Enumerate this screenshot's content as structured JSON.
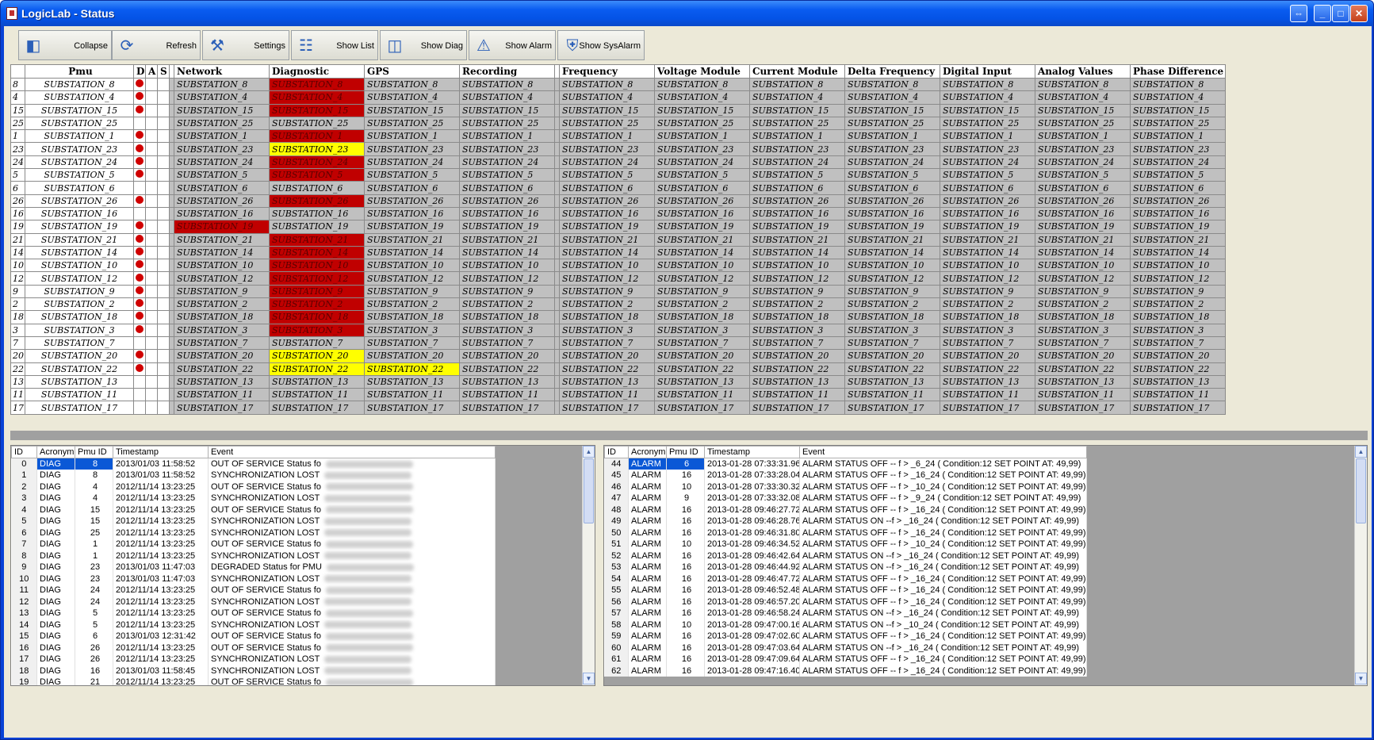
{
  "window": {
    "title": "LogicLab -  Status"
  },
  "toolbar": [
    {
      "label": "Collapse",
      "icon": "collapse-icon"
    },
    {
      "label": "Refresh",
      "icon": "refresh-icon"
    },
    {
      "label": "Settings",
      "icon": "settings-icon"
    },
    {
      "label": "Show List",
      "icon": "list-icon"
    },
    {
      "label": "Show Diag",
      "icon": "diag-icon"
    },
    {
      "label": "Show Alarm",
      "icon": "alarm-icon"
    },
    {
      "label": "Show SysAlarm",
      "icon": "sysalarm-icon"
    }
  ],
  "grid": {
    "columns": [
      "Pmu",
      "D",
      "A",
      "S",
      "Network",
      "Diagnostic",
      "GPS",
      "Recording",
      "Frequency",
      "Voltage Module",
      "Current Module",
      "Delta Frequency",
      "Digital Input",
      "Analog Values",
      "Phase Difference"
    ],
    "status_colors": {
      "red": "#c00000",
      "yellow": "#ffff00",
      "gray": "#c0c0c0"
    },
    "rows": [
      {
        "id": "8",
        "name": "SUBSTATION_8",
        "d": true,
        "net": "",
        "diag": "red",
        "gps": ""
      },
      {
        "id": "4",
        "name": "SUBSTATION_4",
        "d": true,
        "net": "",
        "diag": "red",
        "gps": ""
      },
      {
        "id": "15",
        "name": "SUBSTATION_15",
        "d": true,
        "net": "",
        "diag": "red",
        "gps": ""
      },
      {
        "id": "25",
        "name": "SUBSTATION_25",
        "d": false,
        "net": "",
        "diag": "",
        "gps": ""
      },
      {
        "id": "1",
        "name": "SUBSTATION_1",
        "d": true,
        "net": "",
        "diag": "red",
        "gps": ""
      },
      {
        "id": "23",
        "name": "SUBSTATION_23",
        "d": true,
        "net": "",
        "diag": "yellow",
        "gps": ""
      },
      {
        "id": "24",
        "name": "SUBSTATION_24",
        "d": true,
        "net": "",
        "diag": "red",
        "gps": ""
      },
      {
        "id": "5",
        "name": "SUBSTATION_5",
        "d": true,
        "net": "",
        "diag": "red",
        "gps": ""
      },
      {
        "id": "6",
        "name": "SUBSTATION_6",
        "d": false,
        "net": "",
        "diag": "",
        "gps": ""
      },
      {
        "id": "26",
        "name": "SUBSTATION_26",
        "d": true,
        "net": "",
        "diag": "red",
        "gps": ""
      },
      {
        "id": "16",
        "name": "SUBSTATION_16",
        "d": false,
        "net": "",
        "diag": "",
        "gps": ""
      },
      {
        "id": "19",
        "name": "SUBSTATION_19",
        "d": true,
        "net": "red",
        "diag": "",
        "gps": ""
      },
      {
        "id": "21",
        "name": "SUBSTATION_21",
        "d": true,
        "net": "",
        "diag": "red",
        "gps": ""
      },
      {
        "id": "14",
        "name": "SUBSTATION_14",
        "d": true,
        "net": "",
        "diag": "red",
        "gps": ""
      },
      {
        "id": "10",
        "name": "SUBSTATION_10",
        "d": true,
        "net": "",
        "diag": "red",
        "gps": ""
      },
      {
        "id": "12",
        "name": "SUBSTATION_12",
        "d": true,
        "net": "",
        "diag": "red",
        "gps": ""
      },
      {
        "id": "9",
        "name": "SUBSTATION_9",
        "d": true,
        "net": "",
        "diag": "red",
        "gps": ""
      },
      {
        "id": "2",
        "name": "SUBSTATION_2",
        "d": true,
        "net": "",
        "diag": "red",
        "gps": ""
      },
      {
        "id": "18",
        "name": "SUBSTATION_18",
        "d": true,
        "net": "",
        "diag": "red",
        "gps": ""
      },
      {
        "id": "3",
        "name": "SUBSTATION_3",
        "d": true,
        "net": "",
        "diag": "red",
        "gps": ""
      },
      {
        "id": "7",
        "name": "SUBSTATION_7",
        "d": false,
        "net": "",
        "diag": "",
        "gps": ""
      },
      {
        "id": "20",
        "name": "SUBSTATION_20",
        "d": true,
        "net": "",
        "diag": "yellow",
        "gps": ""
      },
      {
        "id": "22",
        "name": "SUBSTATION_22",
        "d": true,
        "net": "",
        "diag": "yellow",
        "gps": "yellow"
      },
      {
        "id": "13",
        "name": "SUBSTATION_13",
        "d": false,
        "net": "",
        "diag": "",
        "gps": ""
      },
      {
        "id": "11",
        "name": "SUBSTATION_11",
        "d": false,
        "net": "",
        "diag": "",
        "gps": ""
      },
      {
        "id": "17",
        "name": "SUBSTATION_17",
        "d": false,
        "net": "",
        "diag": "",
        "gps": ""
      }
    ]
  },
  "diag_log": {
    "columns": [
      "ID",
      "Acronym",
      "Pmu ID",
      "Timestamp",
      "Event"
    ],
    "rows": [
      [
        "0",
        "DIAG",
        "8",
        "2013/01/03 11:58:52",
        "OUT OF SERVICE Status fo"
      ],
      [
        "1",
        "DIAG",
        "8",
        "2013/01/03 11:58:52",
        "SYNCHRONIZATION LOST"
      ],
      [
        "2",
        "DIAG",
        "4",
        "2012/11/14 13:23:25",
        "OUT OF SERVICE Status fo"
      ],
      [
        "3",
        "DIAG",
        "4",
        "2012/11/14 13:23:25",
        "SYNCHRONIZATION LOST"
      ],
      [
        "4",
        "DIAG",
        "15",
        "2012/11/14 13:23:25",
        "OUT OF SERVICE Status fo"
      ],
      [
        "5",
        "DIAG",
        "15",
        "2012/11/14 13:23:25",
        "SYNCHRONIZATION LOST"
      ],
      [
        "6",
        "DIAG",
        "25",
        "2012/11/14 13:23:25",
        "SYNCHRONIZATION LOST"
      ],
      [
        "7",
        "DIAG",
        "1",
        "2012/11/14 13:23:25",
        "OUT OF SERVICE Status fo"
      ],
      [
        "8",
        "DIAG",
        "1",
        "2012/11/14 13:23:25",
        "SYNCHRONIZATION LOST"
      ],
      [
        "9",
        "DIAG",
        "23",
        "2013/01/03 11:47:03",
        "DEGRADED Status for PMU"
      ],
      [
        "10",
        "DIAG",
        "23",
        "2013/01/03 11:47:03",
        "SYNCHRONIZATION LOST"
      ],
      [
        "11",
        "DIAG",
        "24",
        "2012/11/14 13:23:25",
        "OUT OF SERVICE Status fo"
      ],
      [
        "12",
        "DIAG",
        "24",
        "2012/11/14 13:23:25",
        "SYNCHRONIZATION LOST"
      ],
      [
        "13",
        "DIAG",
        "5",
        "2012/11/14 13:23:25",
        "OUT OF SERVICE Status fo"
      ],
      [
        "14",
        "DIAG",
        "5",
        "2012/11/14 13:23:25",
        "SYNCHRONIZATION LOST"
      ],
      [
        "15",
        "DIAG",
        "6",
        "2013/01/03 12:31:42",
        "OUT OF SERVICE Status fo"
      ],
      [
        "16",
        "DIAG",
        "26",
        "2012/11/14 13:23:25",
        "OUT OF SERVICE Status fo"
      ],
      [
        "17",
        "DIAG",
        "26",
        "2012/11/14 13:23:25",
        "SYNCHRONIZATION LOST"
      ],
      [
        "18",
        "DIAG",
        "16",
        "2013/01/03 11:58:45",
        "SYNCHRONIZATION LOST"
      ],
      [
        "19",
        "DIAG",
        "21",
        "2012/11/14 13:23:25",
        "OUT OF SERVICE Status fo"
      ]
    ]
  },
  "alarm_log": {
    "columns": [
      "ID",
      "Acronym",
      "Pmu ID",
      "Timestamp",
      "Event"
    ],
    "rows": [
      [
        "44",
        "ALARM",
        "6",
        "2013-01-28 07:33:31.960",
        "ALARM STATUS OFF -- f > _6_24 ( Condition:12 SET POINT AT: 49,99)"
      ],
      [
        "45",
        "ALARM",
        "16",
        "2013-01-28 07:33:28.040",
        "ALARM STATUS OFF -- f > _16_24 ( Condition:12 SET POINT AT: 49,99)"
      ],
      [
        "46",
        "ALARM",
        "10",
        "2013-01-28 07:33:30.320",
        "ALARM STATUS OFF -- f > _10_24 ( Condition:12 SET POINT AT: 49,99)"
      ],
      [
        "47",
        "ALARM",
        "9",
        "2013-01-28 07:33:32.080",
        "ALARM STATUS OFF -- f > _9_24 ( Condition:12 SET POINT AT: 49,99)"
      ],
      [
        "48",
        "ALARM",
        "16",
        "2013-01-28 09:46:27.720",
        "ALARM STATUS OFF -- f > _16_24 ( Condition:12 SET POINT AT: 49,99)"
      ],
      [
        "49",
        "ALARM",
        "16",
        "2013-01-28 09:46:28.760",
        "ALARM STATUS ON --f > _16_24 ( Condition:12 SET POINT AT: 49,99)"
      ],
      [
        "50",
        "ALARM",
        "16",
        "2013-01-28 09:46:31.800",
        "ALARM STATUS OFF -- f > _16_24 ( Condition:12 SET POINT AT: 49,99)"
      ],
      [
        "51",
        "ALARM",
        "10",
        "2013-01-28 09:46:34.520",
        "ALARM STATUS OFF -- f > _10_24 ( Condition:12 SET POINT AT: 49,99)"
      ],
      [
        "52",
        "ALARM",
        "16",
        "2013-01-28 09:46:42.640",
        "ALARM STATUS ON --f > _16_24 ( Condition:12 SET POINT AT: 49,99)"
      ],
      [
        "53",
        "ALARM",
        "16",
        "2013-01-28 09:46:44.920",
        "ALARM STATUS ON --f > _16_24 ( Condition:12 SET POINT AT: 49,99)"
      ],
      [
        "54",
        "ALARM",
        "16",
        "2013-01-28 09:46:47.720",
        "ALARM STATUS OFF -- f > _16_24 ( Condition:12 SET POINT AT: 49,99)"
      ],
      [
        "55",
        "ALARM",
        "16",
        "2013-01-28 09:46:52.480",
        "ALARM STATUS OFF -- f > _16_24 ( Condition:12 SET POINT AT: 49,99)"
      ],
      [
        "56",
        "ALARM",
        "16",
        "2013-01-28 09:46:57.200",
        "ALARM STATUS OFF -- f > _16_24 ( Condition:12 SET POINT AT: 49,99)"
      ],
      [
        "57",
        "ALARM",
        "16",
        "2013-01-28 09:46:58.240",
        "ALARM STATUS ON --f > _16_24 ( Condition:12 SET POINT AT: 49,99)"
      ],
      [
        "58",
        "ALARM",
        "10",
        "2013-01-28 09:47:00.160",
        "ALARM STATUS ON --f > _10_24 ( Condition:12 SET POINT AT: 49,99)"
      ],
      [
        "59",
        "ALARM",
        "16",
        "2013-01-28 09:47:02.600",
        "ALARM STATUS OFF -- f > _16_24 ( Condition:12 SET POINT AT: 49,99)"
      ],
      [
        "60",
        "ALARM",
        "16",
        "2013-01-28 09:47:03.640",
        "ALARM STATUS ON --f > _16_24 ( Condition:12 SET POINT AT: 49,99)"
      ],
      [
        "61",
        "ALARM",
        "16",
        "2013-01-28 09:47:09.640",
        "ALARM STATUS OFF -- f > _16_24 ( Condition:12 SET POINT AT: 49,99)"
      ],
      [
        "62",
        "ALARM",
        "16",
        "2013-01-28 09:47:16.400",
        "ALARM STATUS OFF -- f > _16_24 ( Condition:12 SET POINT AT: 49,99)"
      ]
    ]
  }
}
